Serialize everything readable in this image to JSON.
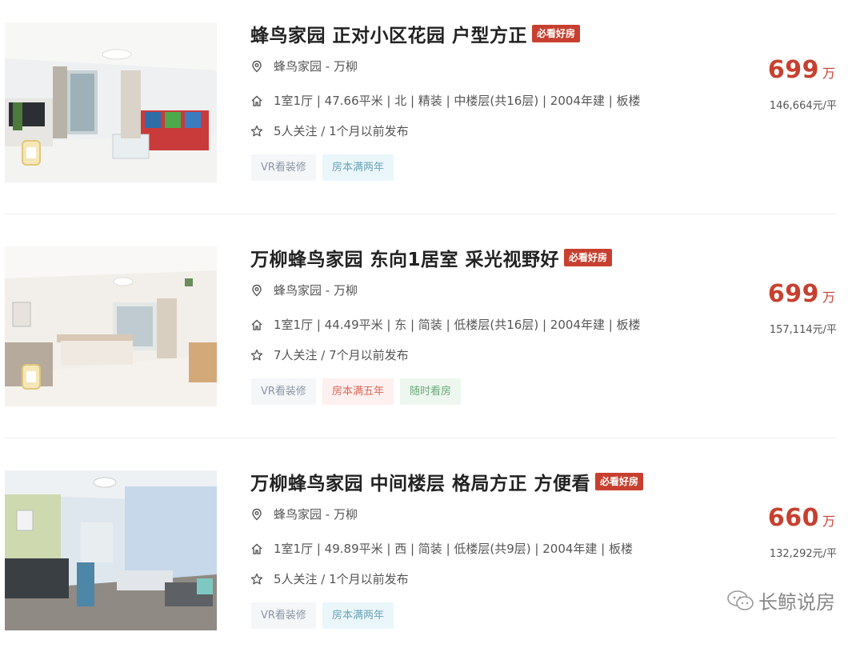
{
  "listings": [
    {
      "title": "蜂鸟家园 正对小区花园 户型方正",
      "badge": "必看好房",
      "community": "蜂鸟家园",
      "area": "万柳",
      "sep": " - ",
      "house_info": "1室1厅 | 47.66平米 | 北 | 精装 | 中楼层(共16层) | 2004年建 | 板楼",
      "follow_info": "5人关注 / 1个月以前发布",
      "tags": [
        "VR看装修",
        "房本满两年"
      ],
      "price": "699",
      "price_unit": "万",
      "unit_price": "146,664元/平"
    },
    {
      "title": "万柳蜂鸟家园 东向1居室 采光视野好",
      "badge": "必看好房",
      "community": "蜂鸟家园",
      "area": "万柳",
      "sep": " - ",
      "house_info": "1室1厅 | 44.49平米 | 东 | 简装 | 低楼层(共16层) | 2004年建 | 板楼",
      "follow_info": "7人关注 / 7个月以前发布",
      "tags": [
        "VR看装修",
        "房本满五年",
        "随时看房"
      ],
      "price": "699",
      "price_unit": "万",
      "unit_price": "157,114元/平"
    },
    {
      "title": "万柳蜂鸟家园 中间楼层 格局方正 方便看",
      "badge": "必看好房",
      "community": "蜂鸟家园",
      "area": "万柳",
      "sep": " - ",
      "house_info": "1室1厅 | 49.89平米 | 西 | 简装 | 低楼层(共9层) | 2004年建 | 板楼",
      "follow_info": "5人关注 / 1个月以前发布",
      "tags": [
        "VR看装修",
        "房本满两年"
      ],
      "price": "660",
      "price_unit": "万",
      "unit_price": "132,292元/平"
    }
  ],
  "watermark": "长鲸说房",
  "colors": {
    "accent": "#c7402f",
    "text": "#222222",
    "muted": "#555555"
  }
}
